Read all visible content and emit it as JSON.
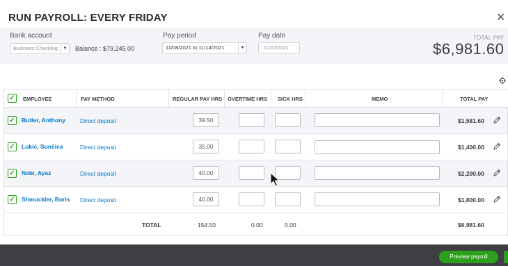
{
  "dialog": {
    "title": "RUN PAYROLL: EVERY FRIDAY"
  },
  "header": {
    "bank_account_label": "Bank account",
    "bank_account_value": "Business Checking",
    "balance": "Balance : $79,245.00",
    "pay_period_label": "Pay period",
    "pay_period_value": "11/08/2021 to 11/14/2021",
    "pay_date_label": "Pay date",
    "pay_date_value": "11/20/2021",
    "total_pay_label": "TOTAL PAY",
    "total_pay_value": "$6,981.60"
  },
  "table": {
    "columns": {
      "employee": "EMPLOYEE",
      "pay_method": "PAY METHOD",
      "regular": "REGULAR PAY HRS",
      "overtime": "OVERTIME HRS",
      "sick": "SICK HRS",
      "memo": "MEMO",
      "total_pay": "TOTAL PAY"
    },
    "rows": [
      {
        "name": "Butler, Anthony",
        "method": "Direct deposit",
        "regular": "39.50",
        "overtime": "",
        "sick": "",
        "memo": "",
        "pay": "$1,581.60",
        "checked": true
      },
      {
        "name": "Lukić, Sunčica",
        "method": "Direct deposit",
        "regular": "35.00",
        "overtime": "",
        "sick": "",
        "memo": "",
        "pay": "$1,400.00",
        "checked": true
      },
      {
        "name": "Nabi, Ayaz",
        "method": "Direct deposit",
        "regular": "40.00",
        "overtime": "",
        "sick": "",
        "memo": "",
        "pay": "$2,200.00",
        "checked": true
      },
      {
        "name": "Shmuckler, Boris",
        "method": "Direct deposit",
        "regular": "40.00",
        "overtime": "",
        "sick": "",
        "memo": "",
        "pay": "$1,800.00",
        "checked": true
      }
    ],
    "totals": {
      "label": "TOTAL",
      "regular": "154.50",
      "overtime": "0.00",
      "sick": "0.00",
      "pay": "$6,981.60"
    }
  },
  "footer": {
    "preview_button": "Preview payroll"
  },
  "colors": {
    "accent_green": "#2ca01c",
    "link_blue": "#0077c5",
    "footer_dark": "#3d3f42"
  },
  "icons": {
    "close": "close-icon",
    "settings": "gear-icon",
    "edit": "pencil-icon",
    "check": "checkmark-icon"
  }
}
